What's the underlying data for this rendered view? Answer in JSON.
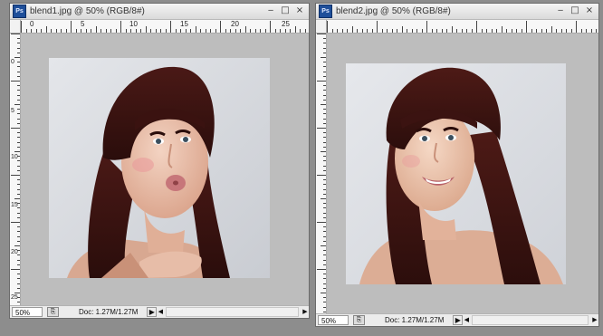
{
  "windows": [
    {
      "title": "blend1.jpg @ 50% (RGB/8#)",
      "app_icon_label": "Ps",
      "buttons": {
        "minimize": "‒",
        "maximize": "□",
        "close": "×"
      },
      "ruler_top": [
        "0",
        "5",
        "10",
        "15",
        "20",
        "25"
      ],
      "ruler_left": [
        "0",
        "5",
        "10",
        "15",
        "20",
        "25",
        "30"
      ],
      "zoom": "50%",
      "doc_info": "Doc: 1.27M/1.27M",
      "nav_arrow": "▶"
    },
    {
      "title": "blend2.jpg @ 50% (RGB/8#)",
      "app_icon_label": "Ps",
      "buttons": {
        "minimize": "‒",
        "maximize": "□",
        "close": "×"
      },
      "ruler_top": [],
      "ruler_left": [],
      "zoom": "50%",
      "doc_info": "Doc: 1.27M/1.27M",
      "nav_arrow": "▶"
    }
  ],
  "colors": {
    "canvas_gray": "#bdbdbd",
    "photo_background": "#d6d9de",
    "hair": "#3a1412",
    "skin": "#e8b9a0",
    "lips": "#c7767a"
  },
  "icons": {
    "app": "photoshop-icon",
    "zoom_status": "page-icon"
  }
}
